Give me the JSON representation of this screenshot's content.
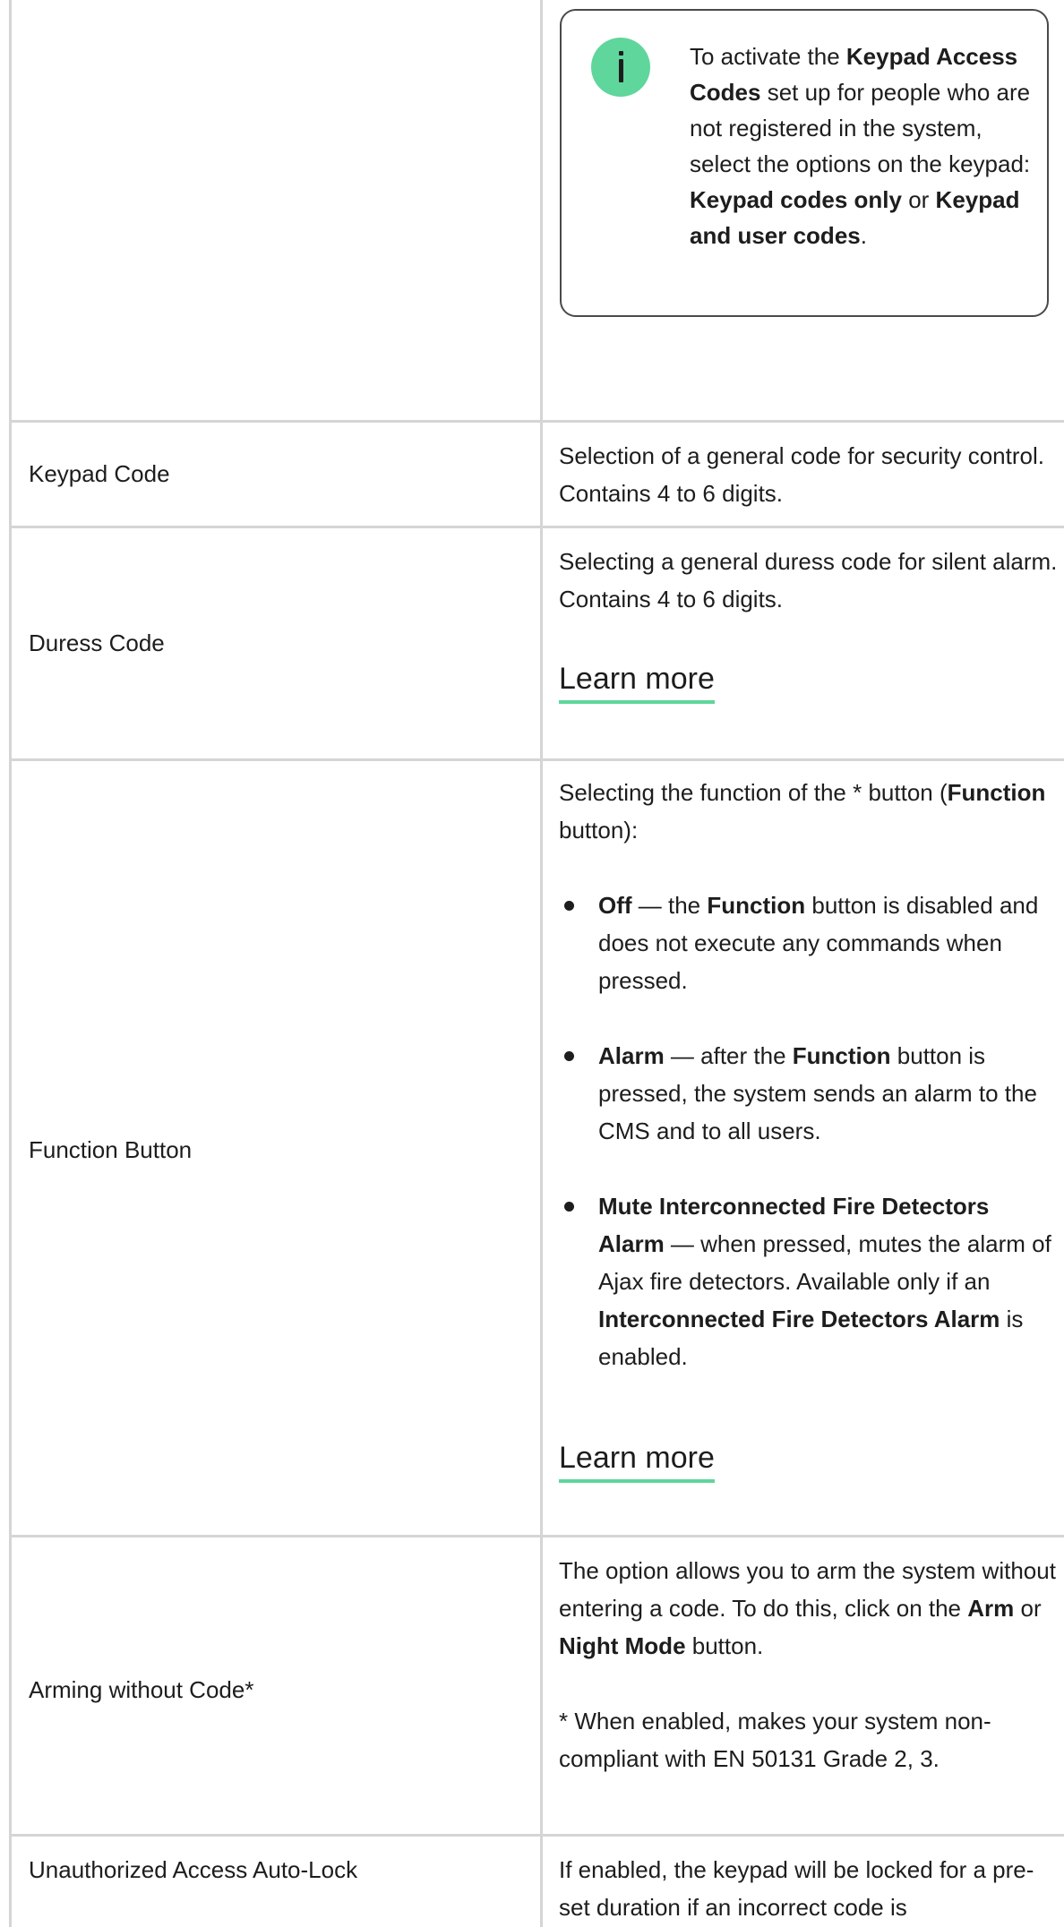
{
  "note": {
    "icon": "info-icon",
    "text_1": "To activate the ",
    "bold_1": "Keypad Access Codes",
    "text_2": " set up for people who are not registered in the system, select the options on the keypad: ",
    "bold_2": "Keypad codes only",
    "text_3": " or ",
    "bold_3": "Keypad and user codes",
    "text_4": "."
  },
  "rows": {
    "keypad_code": {
      "label": "Keypad Code",
      "desc": "Selection of a general code for security control. Contains 4 to 6 digits."
    },
    "duress_code": {
      "label": "Duress Code",
      "desc": "Selecting a general duress code for silent alarm. Contains 4 to 6 digits.",
      "link": "Learn more"
    },
    "function_button": {
      "label": "Function Button",
      "intro_1": "Selecting the function of the * button (",
      "intro_bold": "Function",
      "intro_2": " button):",
      "options": [
        {
          "bold": "Off",
          "t1": " — the ",
          "b2": "Function",
          "t2": " button is disabled and does not execute any commands when pressed."
        },
        {
          "bold": "Alarm",
          "t1": " — after the ",
          "b2": "Function",
          "t2": " button is pressed, the system sends an alarm to the CMS and to all users."
        },
        {
          "bold": "Mute Interconnected Fire Detectors Alarm",
          "t1": " — when pressed, mutes the alarm of Ajax fire detectors. Available only if an ",
          "b2": "Interconnected Fire Detectors Alarm",
          "t2": " is enabled."
        }
      ],
      "link": "Learn more"
    },
    "arming_without_code": {
      "label": "Arming without Code*",
      "p1_1": "The option allows you to arm the system without entering a code. To do this, click on the ",
      "p1_b1": "Arm",
      "p1_2": " or ",
      "p1_b2": "Night Mode",
      "p1_3": " button.",
      "p2": "* When enabled, makes your system non-compliant with EN 50131 Grade 2, 3."
    },
    "auto_lock": {
      "label": "Unauthorized Access Auto-Lock",
      "desc": "If enabled, the keypad will be locked for a pre-set duration if an incorrect code is"
    }
  }
}
